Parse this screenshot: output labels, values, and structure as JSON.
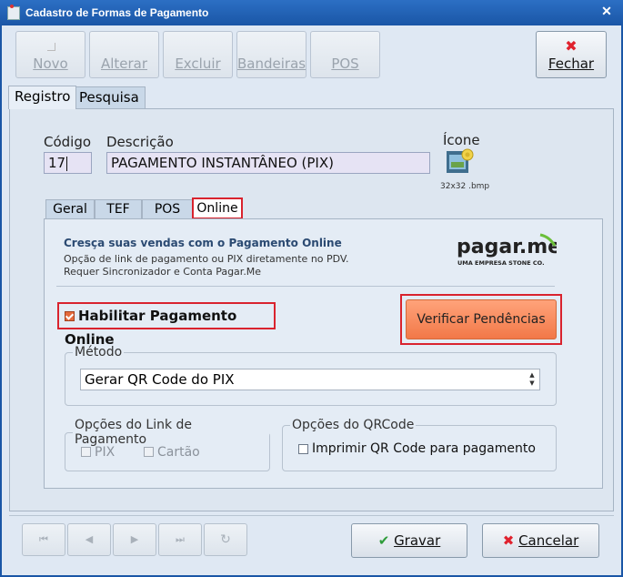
{
  "window": {
    "title": "Cadastro de Formas de Pagamento"
  },
  "toolbar": {
    "novo": "Novo",
    "alterar": "Alterar",
    "excluir": "Excluir",
    "bandeiras": "Bandeiras",
    "pos": "POS",
    "fechar": "Fechar"
  },
  "main_tabs": {
    "registro": "Registro",
    "pesquisa": "Pesquisa"
  },
  "fields": {
    "codigo_label": "Código",
    "codigo_value": "17",
    "descricao_label": "Descrição",
    "descricao_value": "PAGAMENTO INSTANTÂNEO (PIX)",
    "icone_label": "Ícone",
    "icone_caption": "32x32 .bmp"
  },
  "sub_tabs": {
    "geral": "Geral",
    "tef": "TEF",
    "pos": "POS",
    "online": "Online"
  },
  "online": {
    "promo_title": "Cresça suas vendas com o Pagamento Online",
    "promo_line1": "Opção de link de pagamento ou PIX diretamente no PDV.",
    "promo_line2": "Requer Sincronizador e Conta Pagar.Me",
    "logo_text": "pagar.me",
    "logo_sub": "UMA EMPRESA STONE CO.",
    "enable_label": "Habilitar Pagamento Online",
    "verify_label": "Verificar Pendências",
    "metodo_legend": "Método",
    "metodo_value": "Gerar QR Code do PIX",
    "link_legend": "Opções do Link de Pagamento",
    "pix_label": "PIX",
    "cartao_label": "Cartão",
    "qr_legend": "Opções do QRCode",
    "qr_print_label": "Imprimir QR Code para pagamento"
  },
  "footer": {
    "gravar": "Gravar",
    "cancelar": "Cancelar"
  },
  "colors": {
    "title_bar": "#1a56a6",
    "highlight": "#d9232e",
    "accent_button": "#f27848"
  }
}
